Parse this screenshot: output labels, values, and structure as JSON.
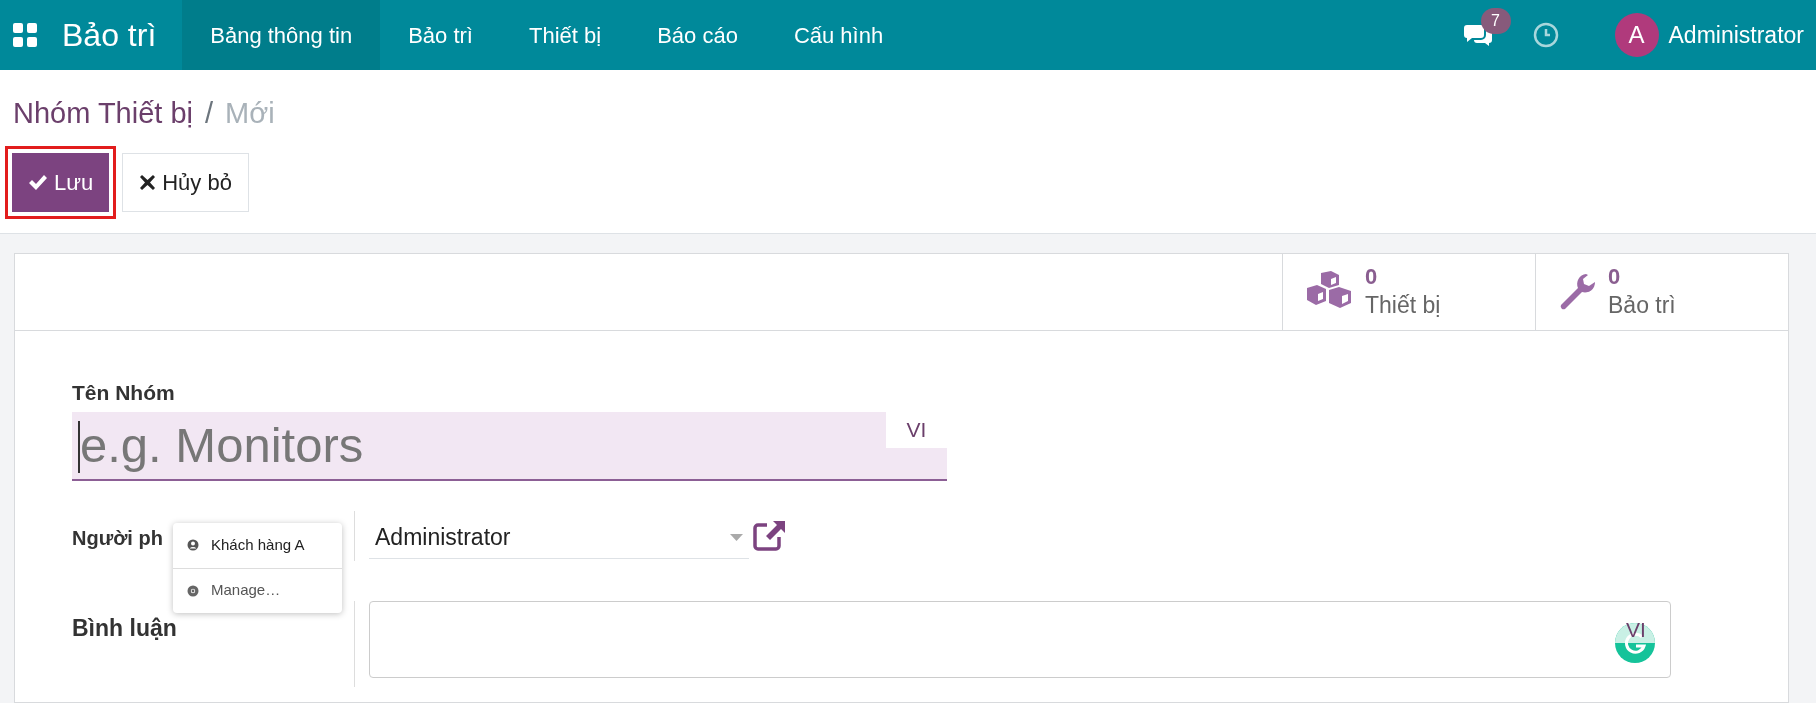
{
  "app": {
    "title": "Bảo trì"
  },
  "menu": [
    {
      "label": "Bảng thông tin",
      "selected": true
    },
    {
      "label": "Bảo trì",
      "selected": false
    },
    {
      "label": "Thiết bị",
      "selected": false
    },
    {
      "label": "Báo cáo",
      "selected": false
    },
    {
      "label": "Cấu hình",
      "selected": false
    }
  ],
  "systray": {
    "messages_count": "7",
    "user_initial": "A",
    "user_name": "Administrator"
  },
  "breadcrumb": [
    {
      "label": "Nhóm Thiết bị",
      "kind": "link"
    },
    {
      "label": "/",
      "kind": "separator"
    },
    {
      "label": "Mới",
      "kind": "current"
    }
  ],
  "actions": [
    {
      "label": "Lưu",
      "kind": "primary",
      "highlighted": true
    },
    {
      "label": "Hủy bỏ",
      "kind": "secondary",
      "highlighted": false
    }
  ],
  "stat_buttons": [
    {
      "count": "0",
      "label": "Thiết bị",
      "kind": "cubes"
    },
    {
      "count": "0",
      "label": "Bảo trì",
      "kind": "wrench"
    }
  ],
  "form": {
    "name_label": "Tên Nhóm",
    "name_placeholder": "e.g. Monitors",
    "name_lang": "VI",
    "responsible_label": "Người ph",
    "responsible_value": "Administrator",
    "comment_label": "Bình luận",
    "comment_lang": "VI"
  },
  "autofill_popup": [
    {
      "label": "Khách hàng A",
      "kind": "contact"
    },
    {
      "label": "Manage…",
      "kind": "manage"
    }
  ]
}
